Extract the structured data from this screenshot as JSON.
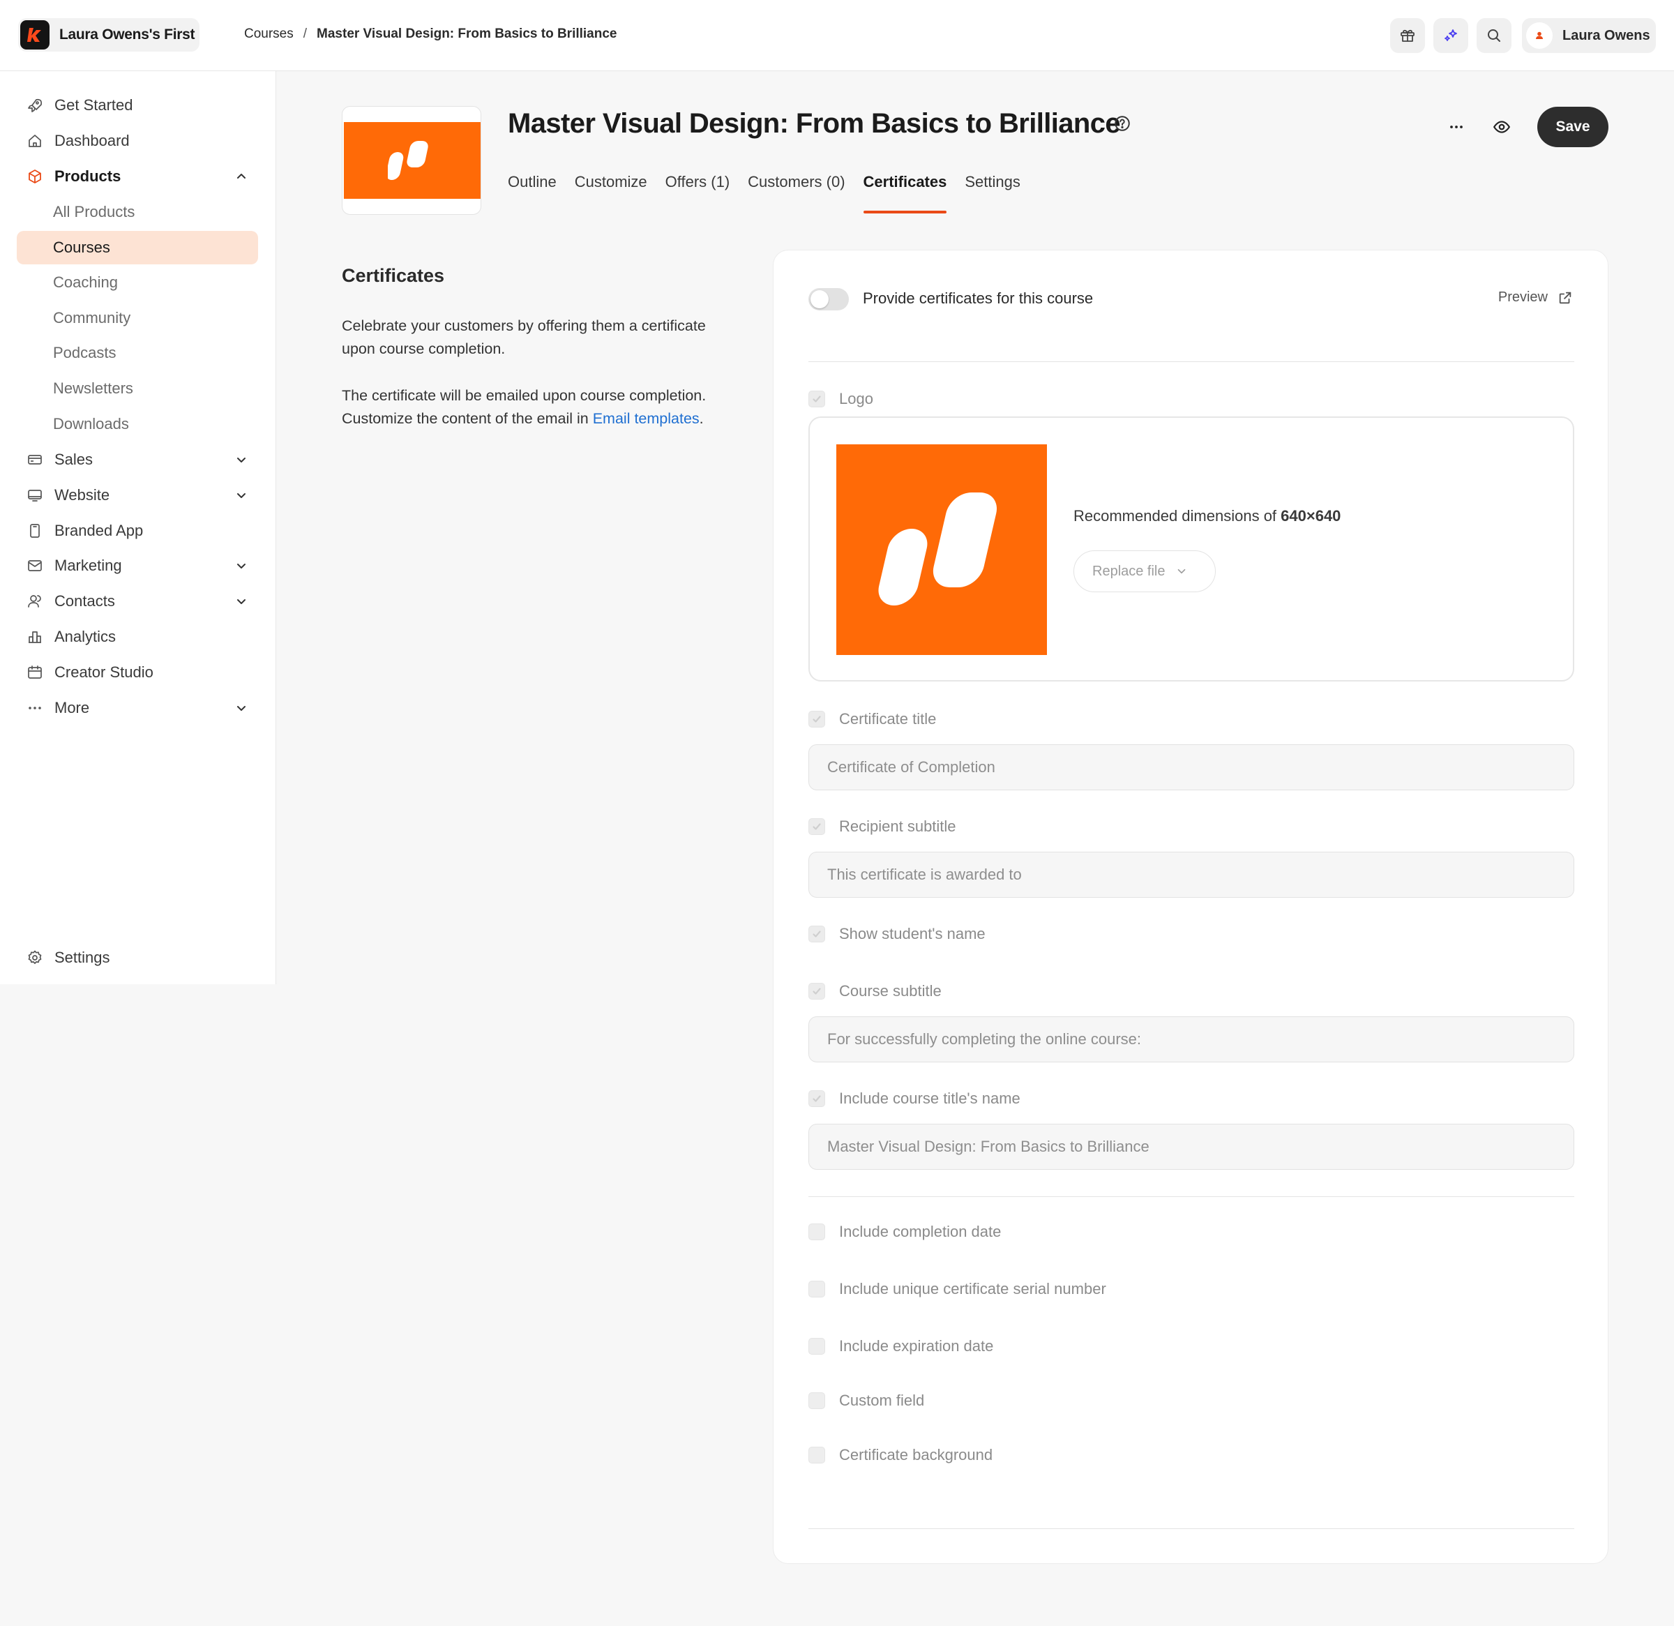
{
  "header": {
    "brand_name": "Laura Owens's First",
    "breadcrumb": [
      "Courses",
      "Master Visual Design: From Basics to Brilliance"
    ],
    "breadcrumb_sep": "/",
    "user_name": "Laura Owens",
    "icons": [
      "gift-icon",
      "sparkle-icon",
      "search-icon"
    ]
  },
  "sidebar": {
    "items": [
      {
        "label": "Get Started",
        "icon": "rocket-icon"
      },
      {
        "label": "Dashboard",
        "icon": "home-icon"
      },
      {
        "label": "Products",
        "icon": "box-icon",
        "expanded": true
      },
      {
        "label": "All Products"
      },
      {
        "label": "Courses",
        "active": true
      },
      {
        "label": "Coaching"
      },
      {
        "label": "Community"
      },
      {
        "label": "Podcasts"
      },
      {
        "label": "Newsletters"
      },
      {
        "label": "Downloads"
      },
      {
        "label": "Sales",
        "icon": "card-icon"
      },
      {
        "label": "Website",
        "icon": "monitor-icon"
      },
      {
        "label": "Branded App",
        "icon": "phone-icon"
      },
      {
        "label": "Marketing",
        "icon": "mail-icon"
      },
      {
        "label": "Contacts",
        "icon": "users-icon"
      },
      {
        "label": "Analytics",
        "icon": "bar-chart-icon"
      },
      {
        "label": "Creator Studio",
        "icon": "calendar-icon"
      },
      {
        "label": "More",
        "icon": "dots-icon"
      }
    ],
    "settings_label": "Settings"
  },
  "product": {
    "title": "Master Visual Design: From Basics to Brilliance",
    "tabs": [
      "Outline",
      "Customize",
      "Offers (1)",
      "Customers (0)",
      "Certificates",
      "Settings"
    ],
    "active_tab": "Certificates",
    "save_label": "Save"
  },
  "certificates": {
    "section_title": "Certificates",
    "desc_1": "Celebrate your customers by offering them a certificate upon course completion.",
    "desc_2_prefix": "The certificate will be emailed upon course completion. Customize the content of the email in ",
    "desc_2_link": "Email templates",
    "desc_2_suffix": ".",
    "toggle_label": "Provide certificates for this course",
    "toggle_on": false,
    "preview_label": "Preview",
    "logo_label": "Logo",
    "logo_recommend_prefix": "Recommended dimensions of ",
    "logo_recommend_value": "640×640",
    "replace_file_label": "Replace file",
    "cert_title_label": "Certificate title",
    "cert_title_value": "Certificate of Completion",
    "recipient_subtitle_label": "Recipient subtitle",
    "recipient_subtitle_value": "This certificate is awarded to",
    "show_name_label": "Show student's name",
    "course_subtitle_label": "Course subtitle",
    "course_subtitle_value": "For successfully completing the online course:",
    "include_course_title_label": "Include course title's name",
    "include_course_title_value": "Master Visual Design: From Basics to Brilliance",
    "optional": [
      "Include completion date",
      "Include unique certificate serial number",
      "Include expiration date",
      "Custom field",
      "Certificate background"
    ]
  },
  "colors": {
    "accent": "#ea4a17",
    "brand_orange": "#ff6a07",
    "active_nav_bg": "#fde3d4",
    "link": "#1f6fd1",
    "save_bg": "#2d2d2d"
  }
}
